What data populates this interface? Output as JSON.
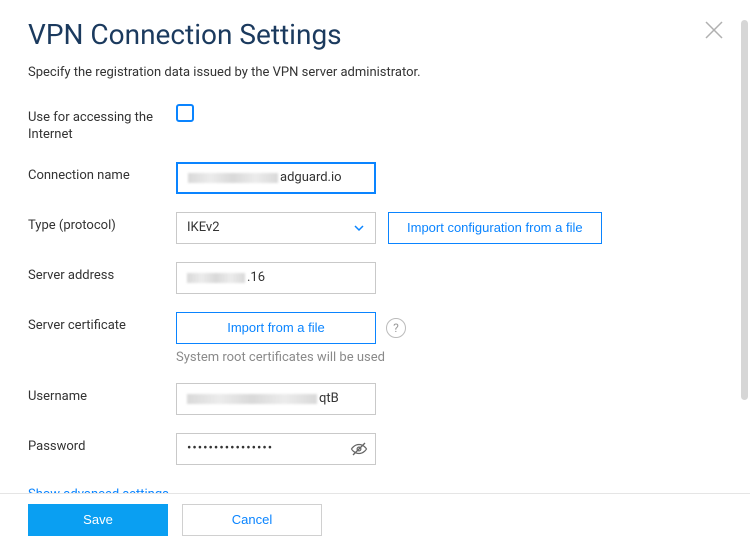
{
  "title": "VPN Connection Settings",
  "subtitle": "Specify the registration data issued by the VPN server administrator.",
  "labels": {
    "use_internet": "Use for accessing the Internet",
    "connection_name": "Connection name",
    "type": "Type (protocol)",
    "server_address": "Server address",
    "server_certificate": "Server certificate",
    "username": "Username",
    "password": "Password"
  },
  "values": {
    "connection_name_suffix": "adguard.io",
    "protocol": "IKEv2",
    "server_address_suffix": ".16",
    "username_suffix": "qtB",
    "password_masked": "••••••••••••••••"
  },
  "buttons": {
    "import_config": "Import configuration from a file",
    "import_file": "Import from a file",
    "save": "Save",
    "cancel": "Cancel"
  },
  "helper": {
    "root_certs": "System root certificates will be used"
  },
  "links": {
    "advanced": "Show advanced settings"
  },
  "icons": {
    "help": "?"
  },
  "colors": {
    "accent": "#0a84ff",
    "primary_btn": "#0a9ff2",
    "title": "#1b3a5e"
  }
}
